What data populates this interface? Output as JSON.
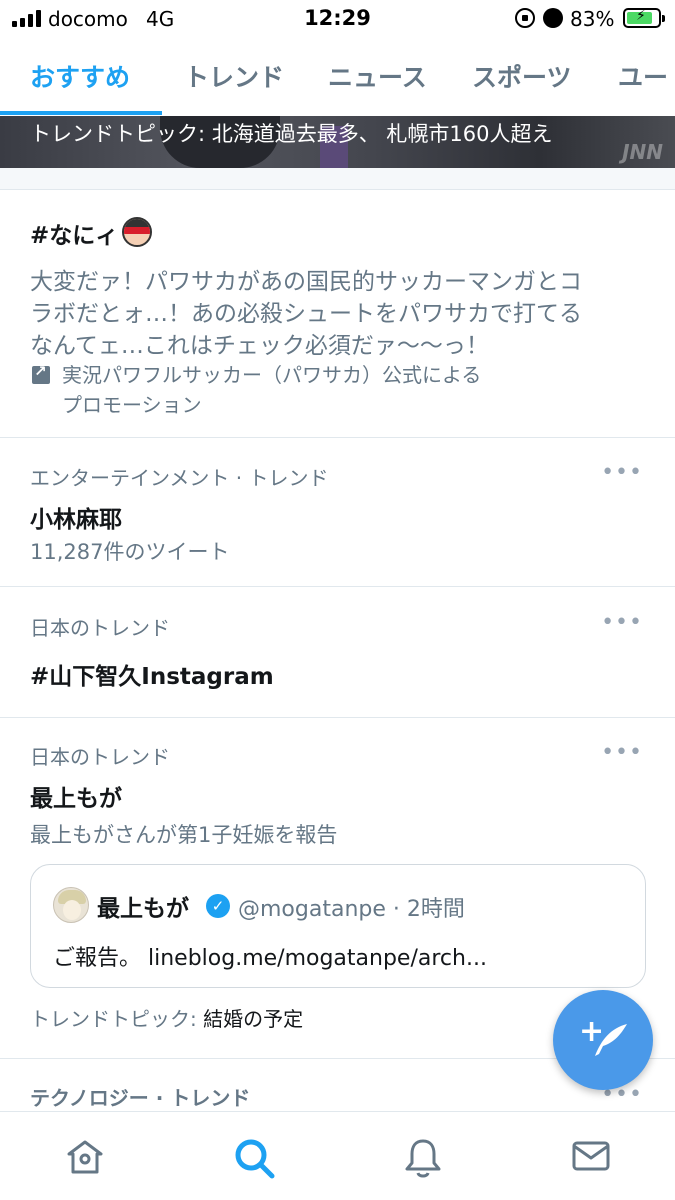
{
  "status_bar": {
    "carrier": "docomo",
    "network": "4G",
    "time": "12:29",
    "battery_percent": "83%",
    "battery_level": 0.83
  },
  "tabs": [
    {
      "label": "おすすめ",
      "active": true
    },
    {
      "label": "トレンド",
      "active": false
    },
    {
      "label": "ニュース",
      "active": false
    },
    {
      "label": "スポーツ",
      "active": false
    },
    {
      "label": "ユー",
      "active": false
    }
  ],
  "banner": {
    "caption": "トレンドトピック: 北海道過去最多、 札幌市160人超え",
    "watermark": "JNN"
  },
  "promoted": {
    "title": "#なにィ",
    "body_lines": [
      "大変だァ！パワサカがあの国民的サッカーマンガとコ",
      "ラボだとォ…！あの必殺シュートをパワサカで打てる",
      "なんてェ…これはチェック必須だァ〜〜っ！"
    ],
    "promoted_by_lines": [
      "実況パワフルサッカー（パワサカ）公式による",
      "プロモーション"
    ]
  },
  "trends": [
    {
      "meta": "エンターテインメント · トレンド",
      "title": "小林麻耶",
      "sub": "11,287件のツイート"
    },
    {
      "meta": "日本のトレンド",
      "title": "#山下智久Instagram",
      "sub": ""
    },
    {
      "meta": "日本のトレンド",
      "title": "最上もが",
      "sub": "最上もがさんが第1子妊娠を報告"
    }
  ],
  "tweet_card": {
    "name": "最上もが",
    "handle_time": "@mogatanpe · 2時間",
    "text": "ご報告。 lineblog.me/mogatanpe/arch..."
  },
  "trend_topic": {
    "label": "トレンドトピック:",
    "value": "結婚の予定"
  },
  "next_trend": {
    "meta": "テクノロジー · トレンド"
  },
  "more_label": "•••",
  "fab": {
    "icon": "compose-tweet-icon",
    "plus": "+"
  },
  "bottom_nav": [
    {
      "icon": "home-icon"
    },
    {
      "icon": "search-icon",
      "active": true
    },
    {
      "icon": "bell-icon"
    },
    {
      "icon": "mail-icon"
    }
  ],
  "colors": {
    "accent": "#1da1f2",
    "secondary_text": "#657786",
    "fab": "#4a99e9"
  }
}
